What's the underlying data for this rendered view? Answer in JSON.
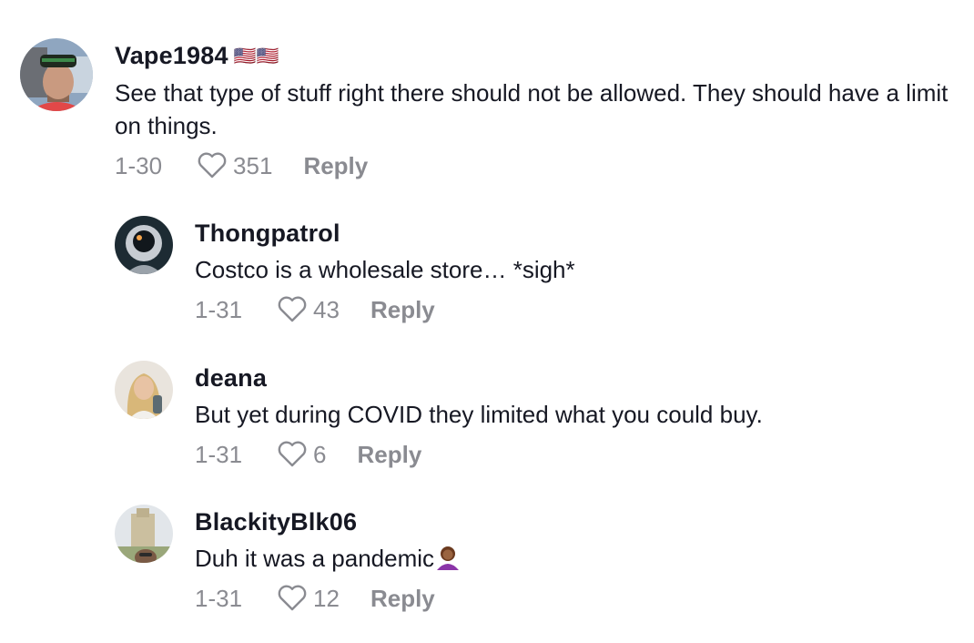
{
  "comments": [
    {
      "username": "Vape1984",
      "flags": "🇺🇸🇺🇸",
      "text": "See that type of stuff right there should not be allowed. They should have a limit on things.",
      "date": "1-30",
      "likes": "351",
      "reply_label": "Reply"
    },
    {
      "username": "Thongpatrol",
      "text": "Costco is a wholesale store… *sigh*",
      "date": "1-31",
      "likes": "43",
      "reply_label": "Reply"
    },
    {
      "username": "deana",
      "text": "But yet during COVID they limited what you could buy.",
      "date": "1-31",
      "likes": "6",
      "reply_label": "Reply"
    },
    {
      "username": "BlackityBlk06",
      "text": "Duh it was a pandemic",
      "date": "1-31",
      "likes": "12",
      "reply_label": "Reply"
    }
  ]
}
